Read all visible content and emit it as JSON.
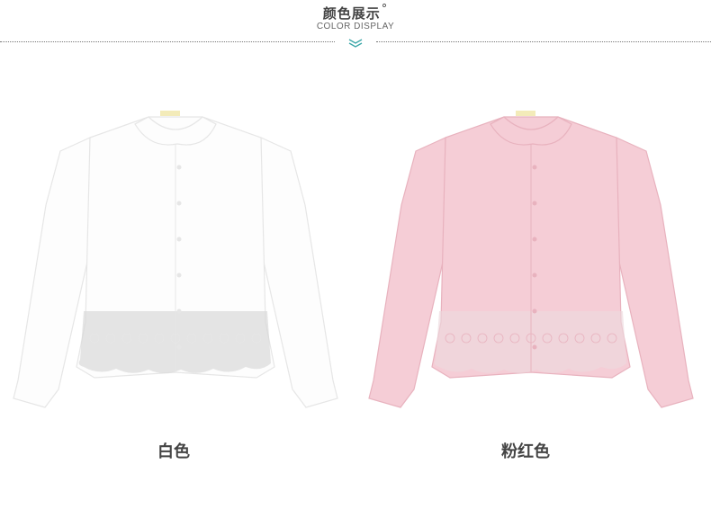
{
  "header": {
    "title": "颜色展示",
    "degree": "°",
    "subtitle": "COLOR DISPLAY"
  },
  "products": [
    {
      "label": "白色",
      "icon": "white-shirt-image",
      "color": "#fdfdfd",
      "shade": "#e6e6e6",
      "lace": "#d7d7d7"
    },
    {
      "label": "粉红色",
      "icon": "pink-shirt-image",
      "color": "#f5cdd6",
      "shade": "#e8b2be",
      "lace": "#ecd9dd"
    }
  ],
  "colors": {
    "divider": "#777777",
    "chevron": "#3aa6a8",
    "label": "#444444"
  }
}
